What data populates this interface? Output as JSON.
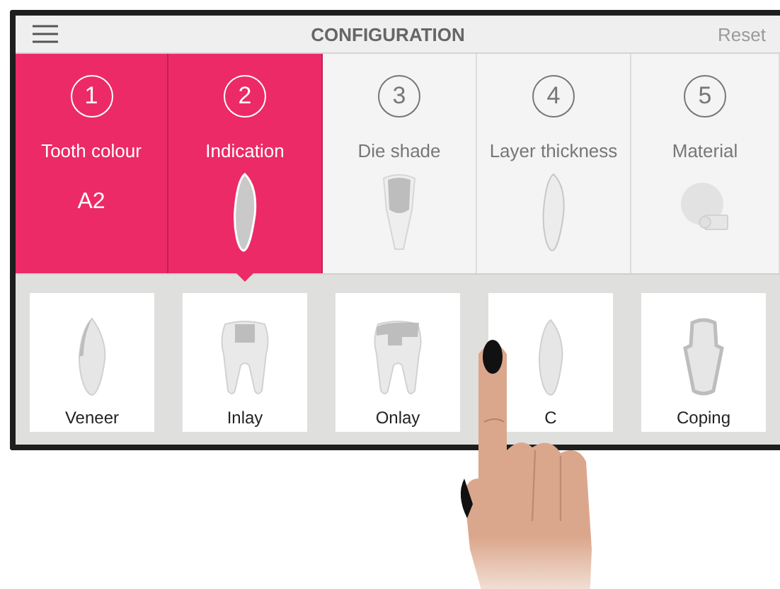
{
  "header": {
    "title": "CONFIGURATION",
    "action": "Reset"
  },
  "steps": [
    {
      "number": "1",
      "label": "Tooth colour",
      "value": "A2",
      "completed": true,
      "selected": false
    },
    {
      "number": "2",
      "label": "Indication",
      "completed": true,
      "selected": true
    },
    {
      "number": "3",
      "label": "Die shade",
      "completed": false,
      "selected": false
    },
    {
      "number": "4",
      "label": "Layer thickness",
      "completed": false,
      "selected": false
    },
    {
      "number": "5",
      "label": "Material",
      "completed": false,
      "selected": false
    }
  ],
  "options": [
    {
      "label": "Veneer"
    },
    {
      "label": "Inlay"
    },
    {
      "label": "Onlay"
    },
    {
      "label": "C"
    },
    {
      "label": "Coping"
    }
  ]
}
